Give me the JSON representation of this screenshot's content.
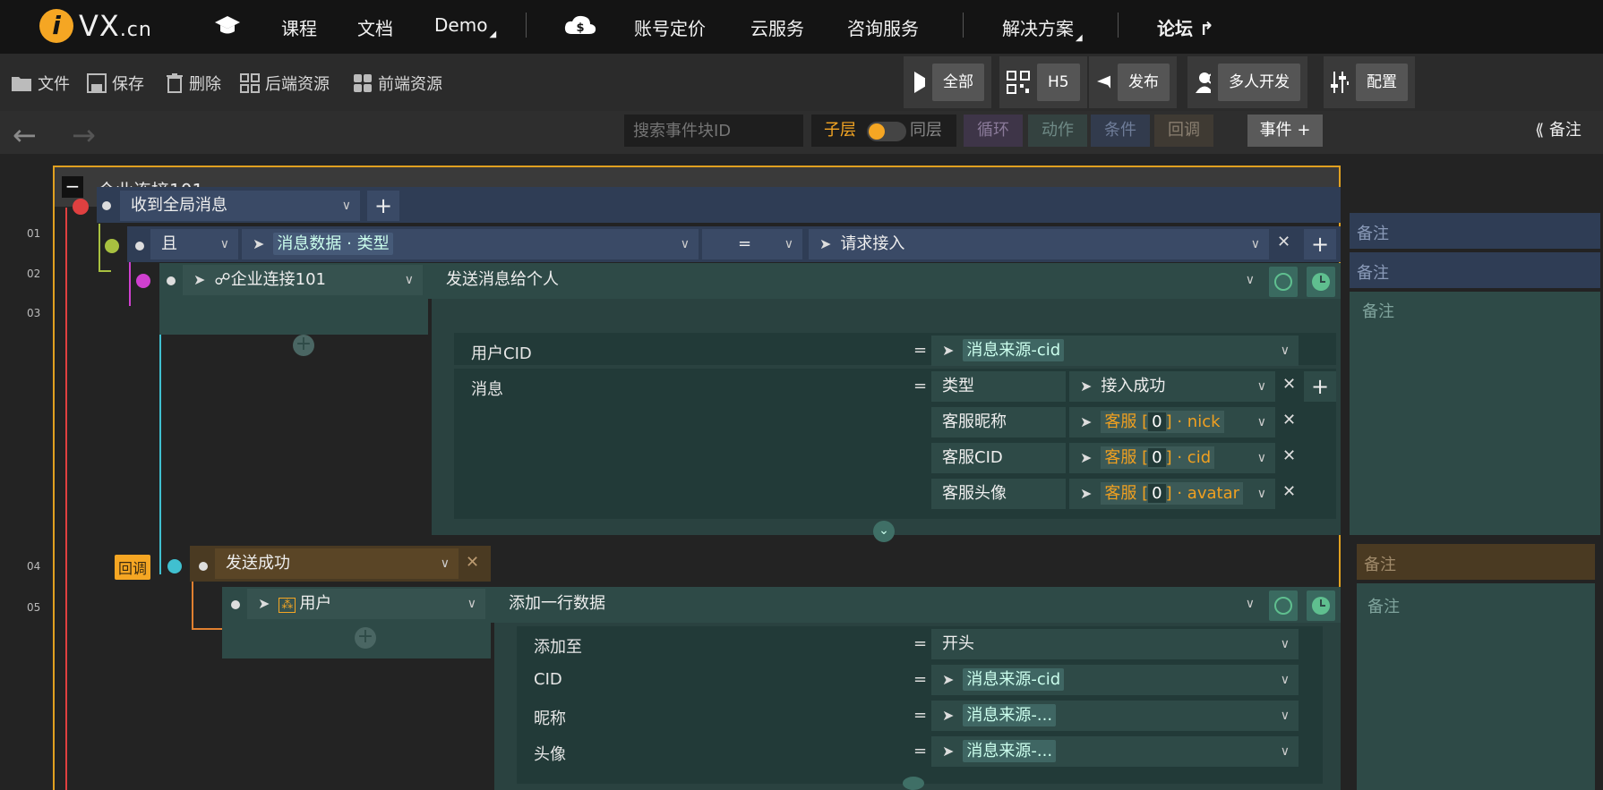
{
  "brand": {
    "logo_letter": "i",
    "name": "VX",
    "tld": ".cn"
  },
  "topnav": {
    "items": [
      "课程",
      "文档",
      "Demo",
      "账号定价",
      "云服务",
      "咨询服务",
      "解决方案",
      "论坛"
    ]
  },
  "toolbar": {
    "left": [
      "文件",
      "保存",
      "删除",
      "后端资源",
      "前端资源"
    ],
    "right": [
      "全部",
      "H5",
      "发布",
      "多人开发",
      "配置"
    ]
  },
  "bar3": {
    "search_placeholder": "搜索事件块ID",
    "sub_layer": "子层",
    "same_layer": "同层",
    "filters": [
      "循环",
      "动作",
      "条件",
      "回调"
    ],
    "event_button": "事件",
    "note_toggle": "备注"
  },
  "panel": {
    "title": "企业连接101",
    "line_numbers": [
      "01",
      "02",
      "03",
      "04",
      "05"
    ],
    "row1": {
      "trigger": "收到全局消息"
    },
    "row2": {
      "logic": "且",
      "left_operand": "消息数据 · 类型",
      "operator": "=",
      "right_operand": "请求接入"
    },
    "row3": {
      "target": "企业连接101",
      "action": "发送消息给个人",
      "params": [
        {
          "label": "用户CID",
          "value": "消息来源-cid"
        },
        {
          "label": "消息",
          "value": "类型",
          "value2": "接入成功"
        }
      ],
      "sub_params": [
        {
          "label": "客服昵称",
          "prefix": "客服",
          "index": "0",
          "field": "nick"
        },
        {
          "label": "客服CID",
          "prefix": "客服",
          "index": "0",
          "field": "cid"
        },
        {
          "label": "客服头像",
          "prefix": "客服",
          "index": "0",
          "field": "avatar"
        }
      ]
    },
    "row4": {
      "badge": "回调",
      "callback": "发送成功"
    },
    "row5": {
      "target": "用户",
      "action": "添加一行数据",
      "params": [
        {
          "label": "添加至",
          "value": "开头"
        },
        {
          "label": "CID",
          "value": "消息来源-cid"
        },
        {
          "label": "昵称",
          "value": "消息来源-..."
        },
        {
          "label": "头像",
          "value": "消息来源-..."
        }
      ]
    },
    "eq_sign": "="
  },
  "notes": [
    "备注",
    "备注",
    "备注",
    "备注",
    "备注"
  ],
  "colors": {
    "accent": "#f5a623",
    "panel_border": "#e0a020",
    "row_blue": "#2f3d55",
    "row_teal": "#2e4a47",
    "row_brown": "#4a3a22"
  }
}
